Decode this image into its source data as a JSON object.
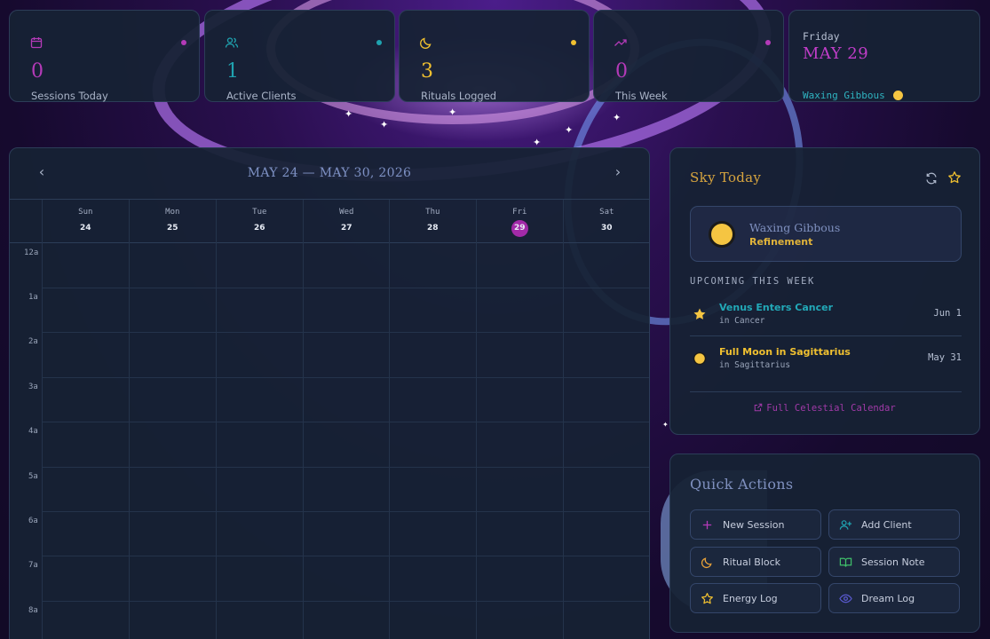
{
  "stats": [
    {
      "value": "0",
      "label": "Sessions Today",
      "icon": "calendar-icon",
      "color": "#b43ab8"
    },
    {
      "value": "1",
      "label": "Active Clients",
      "icon": "users-icon",
      "color": "#1fa3b0"
    },
    {
      "value": "3",
      "label": "Rituals Logged",
      "icon": "moon-icon",
      "color": "#f0c030"
    },
    {
      "value": "0",
      "label": "This Week",
      "icon": "trending-up-icon",
      "color": "#b43ab8"
    }
  ],
  "today": {
    "weekday": "Friday",
    "date": "MAY 29",
    "phase": "Waxing Gibbous"
  },
  "calendar": {
    "range": "MAY 24 — MAY 30, 2026",
    "prev": "‹",
    "next": "›",
    "days": [
      {
        "name": "Sun",
        "num": "24"
      },
      {
        "name": "Mon",
        "num": "25"
      },
      {
        "name": "Tue",
        "num": "26"
      },
      {
        "name": "Wed",
        "num": "27"
      },
      {
        "name": "Thu",
        "num": "28"
      },
      {
        "name": "Fri",
        "num": "29",
        "today": true
      },
      {
        "name": "Sat",
        "num": "30"
      }
    ],
    "hours": [
      "12a",
      "1a",
      "2a",
      "3a",
      "4a",
      "5a",
      "6a",
      "7a",
      "8a"
    ]
  },
  "sky": {
    "title": "Sky Today",
    "phase_name": "Waxing Gibbous",
    "phase_keyword": "Refinement",
    "upcoming_heading": "UPCOMING THIS WEEK",
    "events": [
      {
        "name": "Venus Enters Cancer",
        "sign": "in Cancer",
        "date": "Jun 1",
        "color": "#22a9b8",
        "icon": "star-icon"
      },
      {
        "name": "Full Moon in Sagittarius",
        "sign": "in Sagittarius",
        "date": "May 31",
        "color": "#f0c030",
        "icon": "full-moon-icon"
      }
    ],
    "link": "Full Celestial Calendar"
  },
  "quick_actions": {
    "title": "Quick Actions",
    "buttons": [
      {
        "label": "New Session",
        "icon": "plus-icon"
      },
      {
        "label": "Add Client",
        "icon": "user-plus-icon"
      },
      {
        "label": "Ritual Block",
        "icon": "moon-icon"
      },
      {
        "label": "Session Note",
        "icon": "book-open-icon"
      },
      {
        "label": "Energy Log",
        "icon": "star-icon"
      },
      {
        "label": "Dream Log",
        "icon": "eye-icon"
      }
    ]
  }
}
